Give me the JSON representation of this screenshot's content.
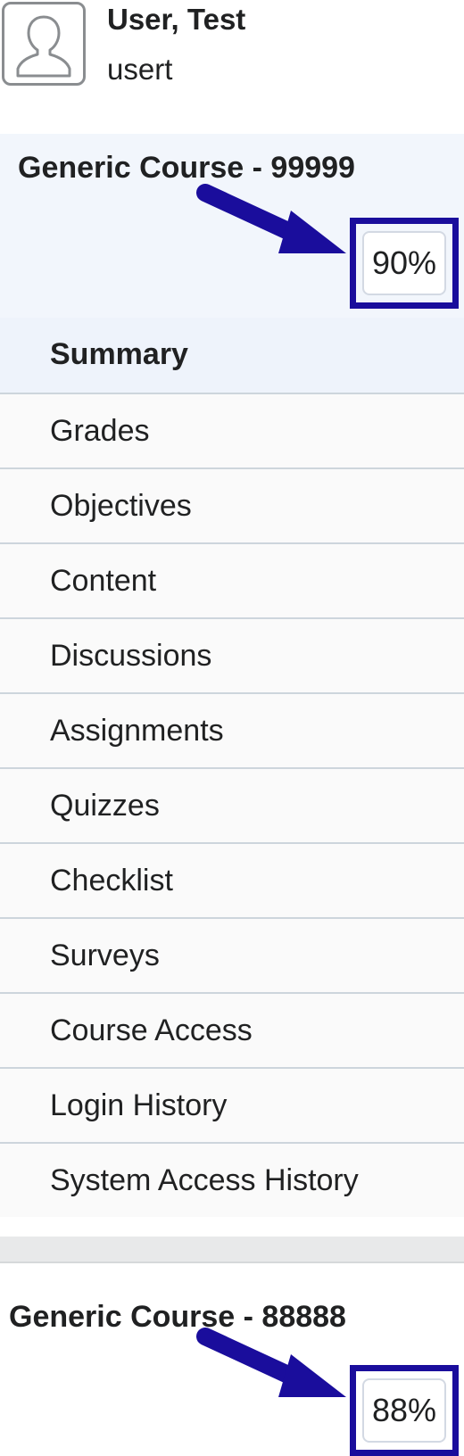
{
  "user": {
    "name": "User, Test",
    "username": "usert"
  },
  "courses": [
    {
      "title": "Generic Course - 99999",
      "grade": "90%",
      "grade_percent": 90
    },
    {
      "title": "Generic Course - 88888",
      "grade": "88%",
      "grade_percent": 88
    }
  ],
  "nav": {
    "items": [
      {
        "label": "Summary",
        "active": true
      },
      {
        "label": "Grades"
      },
      {
        "label": "Objectives"
      },
      {
        "label": "Content"
      },
      {
        "label": "Discussions"
      },
      {
        "label": "Assignments"
      },
      {
        "label": "Quizzes"
      },
      {
        "label": "Checklist"
      },
      {
        "label": "Surveys"
      },
      {
        "label": "Course Access"
      },
      {
        "label": "Login History"
      },
      {
        "label": "System Access History"
      }
    ]
  },
  "colors": {
    "highlight": "#1a0d9c",
    "arrow": "#1a0d9c",
    "card_background": "#f2f6fc",
    "active_item_background": "#eef3fb"
  },
  "icons": {
    "avatar": "user-silhouette-icon",
    "annotation": "arrow-annotation"
  }
}
